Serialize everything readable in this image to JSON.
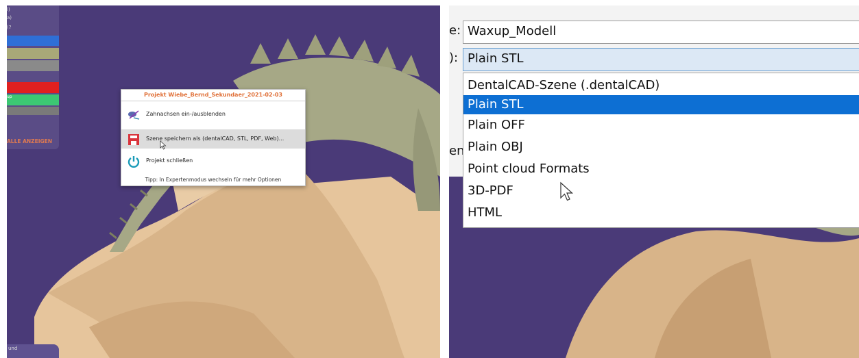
{
  "left": {
    "sidebar": {
      "rows": [
        "l)",
        "a)",
        "(?"
      ],
      "swatches": [
        "#2f6fd6",
        "#a8a878",
        "#8a8a8a",
        "#e02020",
        "#3cc873"
      ],
      "swatch_label": "up",
      "show_all": "ALLE ANZEIGEN",
      "bottom_label": "und"
    },
    "context_menu": {
      "title": "Projekt Wiebe_Bernd_Sekundaer_2021-02-03",
      "items": [
        {
          "label": "Zahnachsen ein-/ausblenden",
          "icon": "tooth-axis-icon"
        },
        {
          "label": "Szene speichern als (dentalCAD, STL, PDF, Web)...",
          "icon": "save-floppy-icon"
        },
        {
          "label": "Projekt schließen",
          "icon": "power-icon"
        }
      ],
      "tip": "Tipp: In Expertenmodus wechseln für mehr Optionen"
    }
  },
  "right": {
    "name_label_fragment": "e:",
    "name_value": "Waxup_Modell",
    "format_label_fragment": "):",
    "format_value": "Plain STL",
    "clipped_label_fragment": "en",
    "options": [
      "DentalCAD-Szene (.dentalCAD)",
      "Plain STL",
      "Plain OFF",
      "Plain OBJ",
      "Point cloud Formats",
      "3D-PDF",
      "HTML"
    ],
    "selected_index": 1
  },
  "colors": {
    "viewport_bg": "#4a3a78",
    "model_beige": "#e6c59c",
    "teeth_green": "#a6a886",
    "menu_accent": "#e07038",
    "selection_blue": "#0d6fd3",
    "save_icon_red": "#d9343c",
    "power_icon_teal": "#1a9bb8"
  }
}
